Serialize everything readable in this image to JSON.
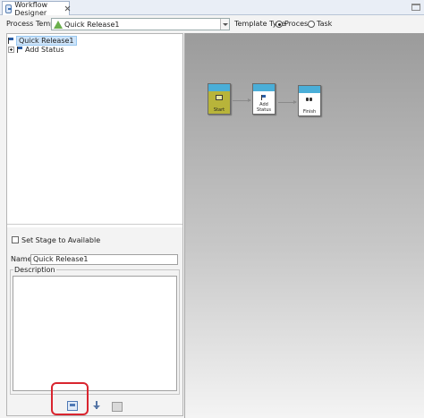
{
  "tab": {
    "title": "Workflow Designer"
  },
  "template": {
    "label": "Process Template",
    "value": "Quick Release1",
    "type_label": "Template Type",
    "options": [
      {
        "label": "Process",
        "selected": true
      },
      {
        "label": "Task",
        "selected": false
      }
    ]
  },
  "tree": {
    "root": "Quick Release1",
    "children": [
      "Add Status"
    ]
  },
  "properties": {
    "stage_available_label": "Set Stage to Available",
    "stage_available_checked": false,
    "name_label": "Name:",
    "name_value": "Quick Release1",
    "description_label": "Description",
    "description_value": ""
  },
  "canvas": {
    "nodes": [
      {
        "label": "Start",
        "icon": "start-icon"
      },
      {
        "label": "Add Status",
        "icon": "status-flag-icon"
      },
      {
        "label": "Finish",
        "icon": "finish-icon"
      }
    ]
  },
  "colors": {
    "start_node": "#b8b43a",
    "node_header": "#4aaed8",
    "highlight": "#d9252f",
    "tree_selection": "#cde4fa"
  }
}
